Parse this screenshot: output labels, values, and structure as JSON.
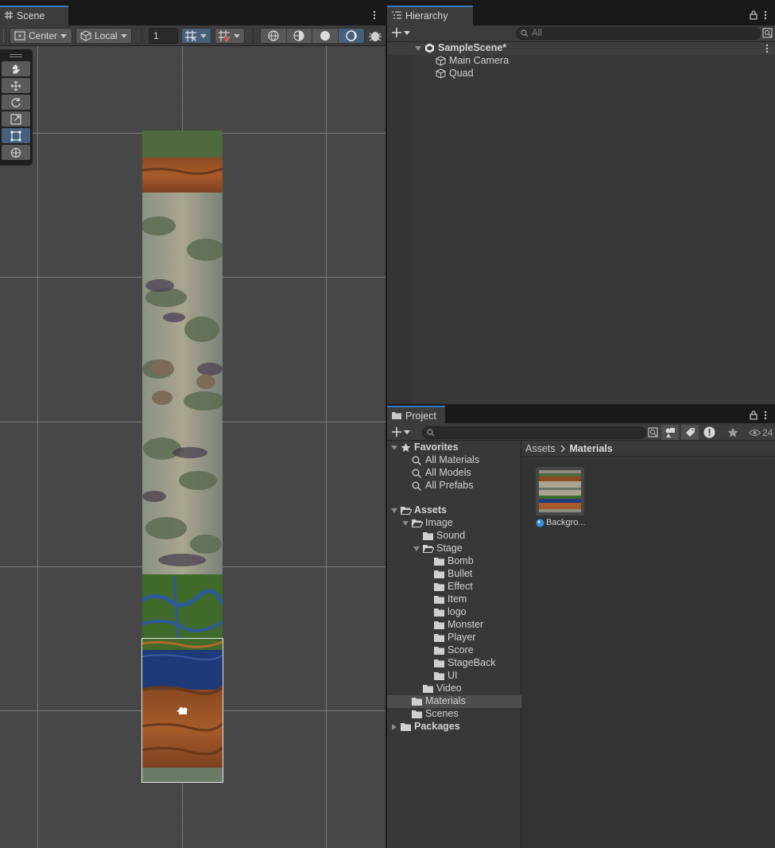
{
  "scene": {
    "tab_label": "Scene",
    "pivot_label": "Center",
    "space_label": "Local",
    "snap_value": "1"
  },
  "hierarchy": {
    "tab_label": "Hierarchy",
    "search_placeholder": "All",
    "scene_name": "SampleScene*",
    "items": [
      "Main Camera",
      "Quad"
    ]
  },
  "project": {
    "tab_label": "Project",
    "visible_count": "24",
    "favorites": {
      "label": "Favorites",
      "items": [
        "All Materials",
        "All Models",
        "All Prefabs"
      ]
    },
    "tree": {
      "assets": "Assets",
      "image": "Image",
      "sound": "Sound",
      "stage": "Stage",
      "stage_children": [
        "Bomb",
        "Bullet",
        "Effect",
        "Item",
        "logo",
        "Monster",
        "Player",
        "Score",
        "StageBack",
        "UI"
      ],
      "video": "Video",
      "materials": "Materials",
      "scenes": "Scenes",
      "packages": "Packages"
    },
    "breadcrumb": [
      "Assets",
      "Materials"
    ],
    "asset_name": "Backgro..."
  },
  "colors": {
    "accent": "#3a79bb",
    "selected_tool": "#46607c"
  }
}
